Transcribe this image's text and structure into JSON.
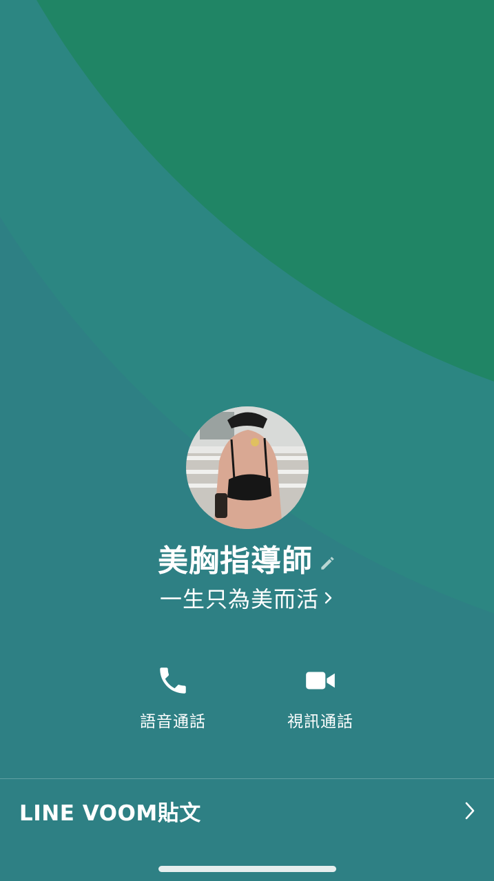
{
  "colors": {
    "background": "#2e8084",
    "top_shape": "#208565",
    "mid_shape": "#2c8682"
  },
  "profile": {
    "name": "美胸指導師",
    "status_message": "一生只為美而活"
  },
  "actions": {
    "voice_call_label": "語音通話",
    "video_call_label": "視訊通話"
  },
  "voom": {
    "label": "LINE VOOM貼文"
  },
  "icons": {
    "edit": "pencil-icon",
    "status_chevron": "chevron-right-icon",
    "voice": "phone-icon",
    "video": "video-camera-icon",
    "voom_chevron": "chevron-right-icon"
  }
}
